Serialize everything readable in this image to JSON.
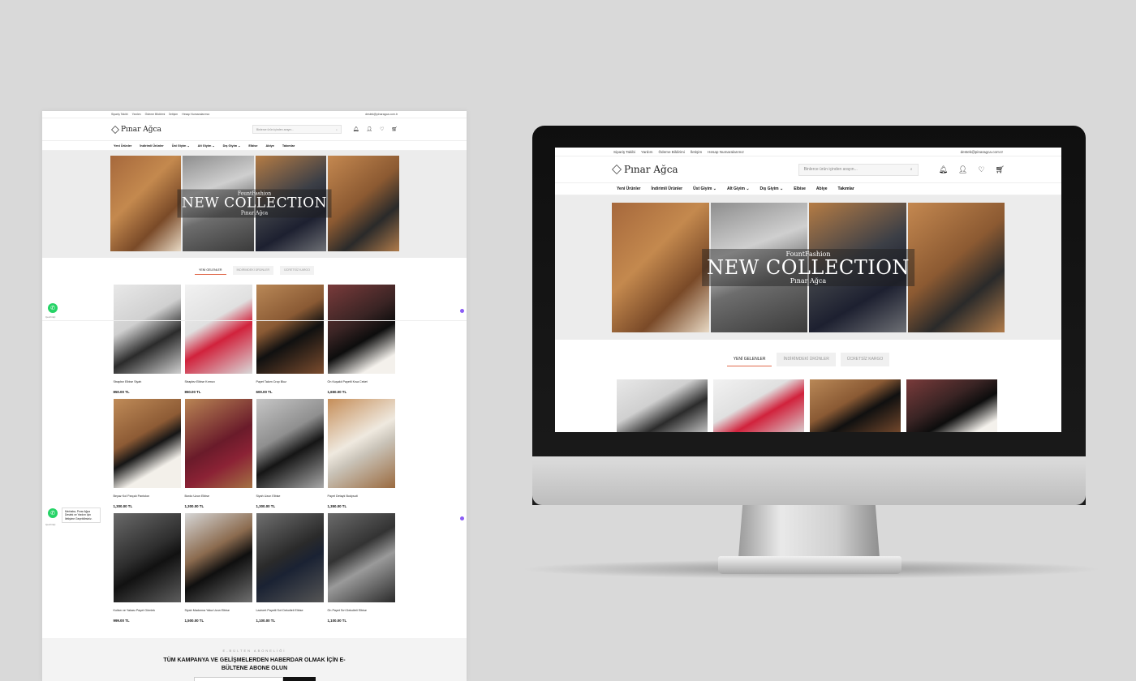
{
  "topbar": {
    "links": [
      "Sipariş Takibi",
      "Yardım",
      "Ödeme Bildirimi",
      "İletişim",
      "Hesap Numaralarımız"
    ],
    "email": "destek@pinaragca.com.tr"
  },
  "header": {
    "logo": "Pınar Ağca",
    "search_placeholder": "Binlerce ürün içinden arayın..."
  },
  "nav": [
    "Yeni Ürünler",
    "İndirimli Ürünler",
    "Üst Giyim ⌄",
    "Alt Giyim ⌄",
    "Dış Giyim ⌄",
    "Elbise",
    "Abiye",
    "Takımlar"
  ],
  "hero": {
    "brand": "FountFashion",
    "headline": "NEW COLLECTION",
    "sub": "Pınar Ağca"
  },
  "tabs": [
    "YENİ GELENLER",
    "İNDİRİMDEKİ ÜRÜNLER",
    "ÜCRETSİZ KARGO"
  ],
  "products": [
    {
      "name": "Straplez Elbise Siyah",
      "price": "850.00 TL"
    },
    {
      "name": "Straplez Elbise Kırmızı",
      "price": "850.00 TL"
    },
    {
      "name": "Payet Takım Crop Bluz",
      "price": "600.00 TL"
    },
    {
      "name": "Ön Kuşaklı Payetli Kısa Ceket",
      "price": "1,650.00 TL"
    },
    {
      "name": "Beyaz Kol Parçalı Pantolon",
      "price": "1,300.00 TL"
    },
    {
      "name": "Bordo Uzun Elbise",
      "price": "1,300.00 TL"
    },
    {
      "name": "Siyah Uzun Elbise",
      "price": "1,300.00 TL"
    },
    {
      "name": "Payet Detaylı Bodysuit",
      "price": "1,350.00 TL"
    },
    {
      "name": "Kolları ve Yakası Payet Gömlek",
      "price": "999.00 TL"
    },
    {
      "name": "Siyah Madonna Yaka Uzun Elbise",
      "price": "1,500.00 TL"
    },
    {
      "name": "Lacivert Payetli Sırt Dekolteli Elbise",
      "price": "1,100.00 TL"
    },
    {
      "name": "Ön Payet Sırt Dekolteli Elbise",
      "price": "1,100.00 TL"
    }
  ],
  "whatsapp": {
    "label": "Çevrimiçi",
    "message": "Merhaba, Pınar Ağca Destek ve Yardım İçin İletişime Geçebilirsiniz."
  },
  "newsletter": {
    "subtitle": "E-BÜLTEN ABONELİĞİ",
    "title": "TÜM KAMPANYA VE GELİŞMELERDEN HABERDAR OLMAK İÇİN E-BÜLTENE ABONE OLUN"
  },
  "icons": [
    "bell-icon",
    "user-icon",
    "heart-icon",
    "cart-icon",
    "search-icon",
    "whatsapp-icon"
  ],
  "colors": {
    "accent": "#e06a4c",
    "background": "#d9d9d9",
    "whatsapp": "#25d366"
  }
}
